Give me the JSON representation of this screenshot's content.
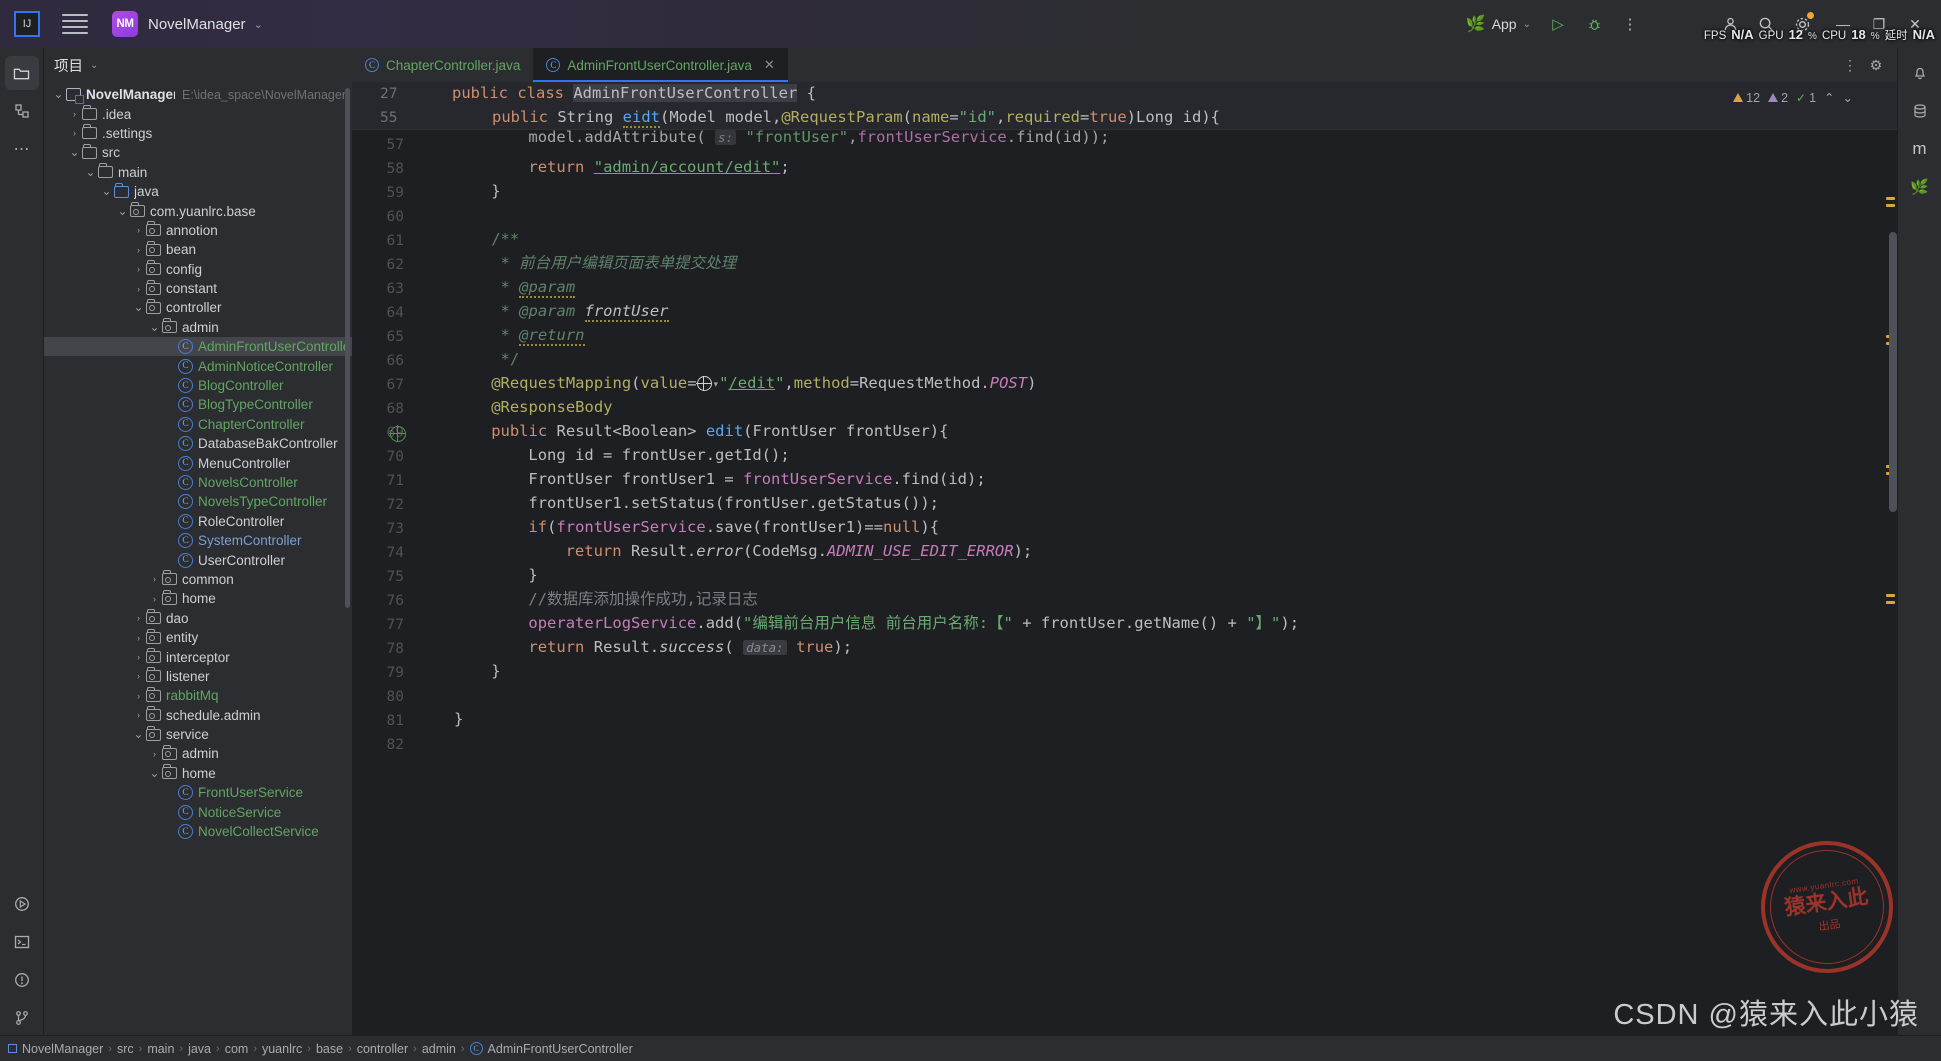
{
  "titlebar": {
    "logo_text": "IJ",
    "menu_icon": "hamburger-icon",
    "project_badge": "NM",
    "project_name": "NovelManager",
    "project_chevron": "⌄",
    "run_config": "App",
    "run_config_chevron": "⌄",
    "run_icon": "▷",
    "debug_icon": "🐞",
    "more_icon": "⋮",
    "account_icon": "person-icon",
    "search_icon": "search-icon",
    "settings_icon": "gear-icon",
    "minimize": "—",
    "maximize": "❐",
    "close": "✕",
    "perf": {
      "fps_label": "FPS",
      "fps_value": "N/A",
      "gpu_label": "GPU",
      "gpu_value": "12",
      "gpu_unit": "%",
      "cpu_label": "CPU",
      "cpu_value": "18",
      "cpu_unit": "%",
      "latency_label": "延时",
      "latency_value": "N/A"
    }
  },
  "left_rail": [
    {
      "name": "project-tool-window",
      "icon": "📁",
      "active": true
    },
    {
      "name": "structure-tool-window",
      "icon": "⊞",
      "active": false
    },
    {
      "name": "more-tool-windows",
      "icon": "⋯",
      "active": false
    },
    {
      "name": "run-tool-window",
      "icon": "▷",
      "active": false
    },
    {
      "name": "terminal-tool-window",
      "icon": "⌘",
      "active": false
    },
    {
      "name": "problems-tool-window",
      "icon": "⊘",
      "active": false
    },
    {
      "name": "version-control-tool-window",
      "icon": "⑂",
      "active": false
    }
  ],
  "right_rail": [
    {
      "name": "notifications",
      "icon": "🔔"
    },
    {
      "name": "database-tool-window",
      "icon": "🗄"
    },
    {
      "name": "maven-tool-window",
      "icon": "m"
    },
    {
      "name": "spring-tool-window",
      "icon": "🍃"
    }
  ],
  "project_panel": {
    "title": "项目",
    "title_chevron": "⌄",
    "tree": [
      {
        "depth": 0,
        "arrow": "⌄",
        "icon": "module",
        "label": "NovelManager",
        "style": "bold",
        "path": "E:\\idea_space\\NovelManager"
      },
      {
        "depth": 1,
        "arrow": "›",
        "icon": "folder",
        "label": ".idea",
        "style": "white"
      },
      {
        "depth": 1,
        "arrow": "›",
        "icon": "folder",
        "label": ".settings",
        "style": "white"
      },
      {
        "depth": 1,
        "arrow": "⌄",
        "icon": "folder",
        "label": "src",
        "style": "white"
      },
      {
        "depth": 2,
        "arrow": "⌄",
        "icon": "folder",
        "label": "main",
        "style": "white"
      },
      {
        "depth": 3,
        "arrow": "⌄",
        "icon": "folder-blue",
        "label": "java",
        "style": "white"
      },
      {
        "depth": 4,
        "arrow": "⌄",
        "icon": "package",
        "label": "com.yuanlrc.base",
        "style": "white"
      },
      {
        "depth": 5,
        "arrow": "›",
        "icon": "package",
        "label": "annotion",
        "style": "white"
      },
      {
        "depth": 5,
        "arrow": "›",
        "icon": "package",
        "label": "bean",
        "style": "white"
      },
      {
        "depth": 5,
        "arrow": "›",
        "icon": "package",
        "label": "config",
        "style": "white"
      },
      {
        "depth": 5,
        "arrow": "›",
        "icon": "package",
        "label": "constant",
        "style": "white"
      },
      {
        "depth": 5,
        "arrow": "⌄",
        "icon": "package",
        "label": "controller",
        "style": "white"
      },
      {
        "depth": 6,
        "arrow": "⌄",
        "icon": "package",
        "label": "admin",
        "style": "white"
      },
      {
        "depth": 7,
        "arrow": "",
        "icon": "class",
        "label": "AdminFrontUserController",
        "style": "green",
        "selected": true
      },
      {
        "depth": 7,
        "arrow": "",
        "icon": "class",
        "label": "AdminNoticeController",
        "style": "green"
      },
      {
        "depth": 7,
        "arrow": "",
        "icon": "class",
        "label": "BlogController",
        "style": "green"
      },
      {
        "depth": 7,
        "arrow": "",
        "icon": "class",
        "label": "BlogTypeController",
        "style": "green"
      },
      {
        "depth": 7,
        "arrow": "",
        "icon": "class",
        "label": "ChapterController",
        "style": "green"
      },
      {
        "depth": 7,
        "arrow": "",
        "icon": "class",
        "label": "DatabaseBakController",
        "style": "white"
      },
      {
        "depth": 7,
        "arrow": "",
        "icon": "class",
        "label": "MenuController",
        "style": "white"
      },
      {
        "depth": 7,
        "arrow": "",
        "icon": "class",
        "label": "NovelsController",
        "style": "green"
      },
      {
        "depth": 7,
        "arrow": "",
        "icon": "class",
        "label": "NovelsTypeController",
        "style": "green"
      },
      {
        "depth": 7,
        "arrow": "",
        "icon": "class",
        "label": "RoleController",
        "style": "white"
      },
      {
        "depth": 7,
        "arrow": "",
        "icon": "class",
        "label": "SystemController",
        "style": "blue"
      },
      {
        "depth": 7,
        "arrow": "",
        "icon": "class",
        "label": "UserController",
        "style": "white"
      },
      {
        "depth": 6,
        "arrow": "›",
        "icon": "package",
        "label": "common",
        "style": "white"
      },
      {
        "depth": 6,
        "arrow": "›",
        "icon": "package",
        "label": "home",
        "style": "white"
      },
      {
        "depth": 5,
        "arrow": "›",
        "icon": "package",
        "label": "dao",
        "style": "white"
      },
      {
        "depth": 5,
        "arrow": "›",
        "icon": "package",
        "label": "entity",
        "style": "white"
      },
      {
        "depth": 5,
        "arrow": "›",
        "icon": "package",
        "label": "interceptor",
        "style": "white"
      },
      {
        "depth": 5,
        "arrow": "›",
        "icon": "package",
        "label": "listener",
        "style": "white"
      },
      {
        "depth": 5,
        "arrow": "›",
        "icon": "package",
        "label": "rabbitMq",
        "style": "green"
      },
      {
        "depth": 5,
        "arrow": "›",
        "icon": "package",
        "label": "schedule.admin",
        "style": "white"
      },
      {
        "depth": 5,
        "arrow": "⌄",
        "icon": "package",
        "label": "service",
        "style": "white"
      },
      {
        "depth": 6,
        "arrow": "›",
        "icon": "package",
        "label": "admin",
        "style": "white"
      },
      {
        "depth": 6,
        "arrow": "⌄",
        "icon": "package",
        "label": "home",
        "style": "white"
      },
      {
        "depth": 7,
        "arrow": "",
        "icon": "class",
        "label": "FrontUserService",
        "style": "green"
      },
      {
        "depth": 7,
        "arrow": "",
        "icon": "class",
        "label": "NoticeService",
        "style": "green"
      },
      {
        "depth": 7,
        "arrow": "",
        "icon": "class",
        "label": "NovelCollectService",
        "style": "green"
      }
    ]
  },
  "editor": {
    "tabs": [
      {
        "label": "ChapterController.java",
        "active": false,
        "style": "green",
        "closable": false
      },
      {
        "label": "AdminFrontUserController.java",
        "active": true,
        "style": "green",
        "closable": true,
        "close_icon": "✕"
      }
    ],
    "tab_actions": {
      "more_icon": "⋮",
      "settings_icon": "⚙"
    },
    "sticky_lines": [
      {
        "num": "27",
        "indent": 4
      },
      {
        "num": "55",
        "indent": 8
      }
    ],
    "inspection": {
      "warnings_icon": "⚠",
      "warnings": "12",
      "weak_icon": "⚠",
      "weak": "2",
      "ok_icon": "✓",
      "ok": "1",
      "up_icon": "⌃",
      "down_icon": "⌄"
    },
    "line_numbers": [
      "57",
      "58",
      "59",
      "60",
      "61",
      "62",
      "63",
      "64",
      "65",
      "66",
      "67",
      "68",
      "69",
      "70",
      "71",
      "72",
      "73",
      "74",
      "75",
      "76",
      "77",
      "78",
      "79",
      "80",
      "81",
      "82"
    ],
    "first_visible_line": 57,
    "gutter_icon_line": 69,
    "gutter_icon_name": "web-endpoint-icon"
  },
  "code": {
    "sticky_27": "public class AdminFrontUserController {",
    "sticky_55": "public String eidt(Model model,@RequestParam(name=\"id\",required=true)Long id){",
    "l57": "model.addAttribute( s: \"frontUser\",frontUserService.find(id));",
    "l58": "return \"admin/account/edit\";",
    "l59": "}",
    "l60": "",
    "l61": "/**",
    "l62": " * 前台用户编辑页面表单提交处理",
    "l63": " * @param",
    "l64": " * @param frontUser",
    "l65": " * @return",
    "l66": " */",
    "l67": "@RequestMapping(value=\"/edit\",method=RequestMethod.POST)",
    "l68": "@ResponseBody",
    "l69": "public Result<Boolean> edit(FrontUser frontUser){",
    "l70": "Long id = frontUser.getId();",
    "l71": "FrontUser frontUser1 = frontUserService.find(id);",
    "l72": "frontUser1.setStatus(frontUser.getStatus());",
    "l73": "if(frontUserService.save(frontUser1)==null){",
    "l74": "return Result.error(CodeMsg.ADMIN_USE_EDIT_ERROR);",
    "l75": "}",
    "l76": "//数据库添加操作成功,记录日志",
    "l77": "operaterLogService.add(\"编辑前台用户信息 前台用户名称:【\" + frontUser.getName() + \"】\");",
    "l78": "return Result.success( data: true);",
    "l79": "}",
    "l80": "",
    "l81": "}",
    "l82": ""
  },
  "status_bar": {
    "breadcrumb": [
      "NovelManager",
      "src",
      "main",
      "java",
      "com",
      "yuanlrc",
      "base",
      "controller",
      "admin",
      "AdminFrontUserController"
    ],
    "separator": "›"
  },
  "watermark": {
    "stamp_top": "www.yuanlrc.com",
    "stamp_main": "猿来入此",
    "stamp_bottom": "出品",
    "csdn_text": "CSDN @猿来入此小猿"
  },
  "colors": {
    "accent": "#3574f0",
    "modified": "#62a662",
    "keyword": "#cf8e6d",
    "string": "#6aab73",
    "annotation": "#b3ae60",
    "field": "#c77dbb",
    "method": "#56a8f5",
    "comment": "#7a7e85",
    "editor_bg": "#1e1f22",
    "panel_bg": "#2b2d30"
  }
}
